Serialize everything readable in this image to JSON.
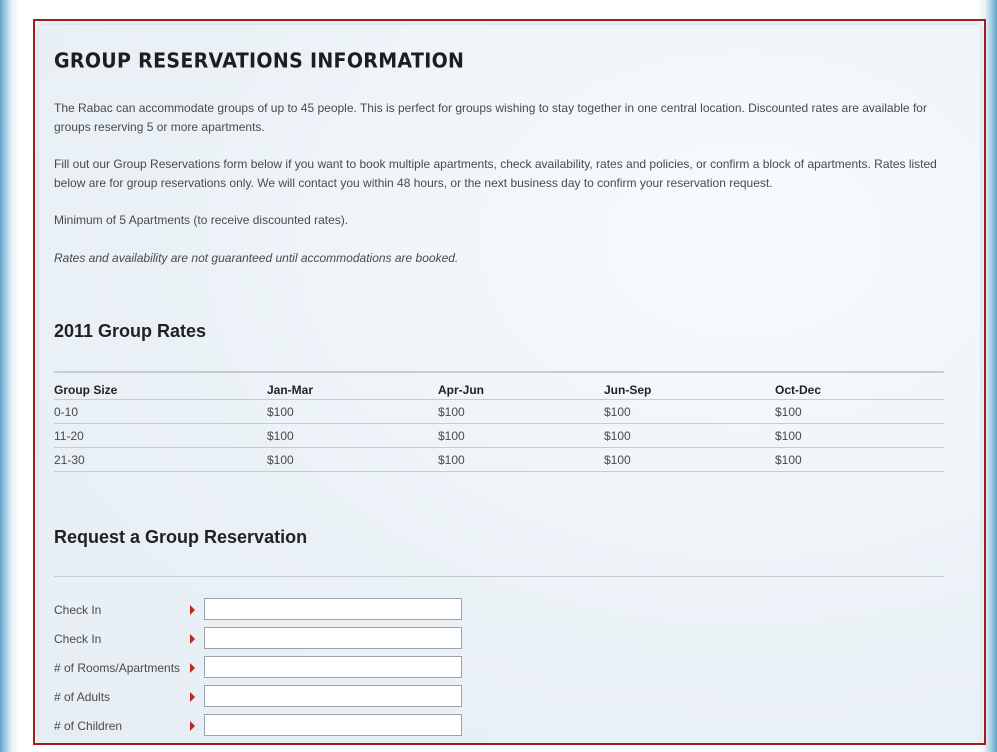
{
  "page": {
    "title": "GROUP RESERVATIONS INFORMATION",
    "paragraphs": [
      "The Rabac can accommodate groups of up to 45 people. This is perfect for groups wishing to stay together in one central location. Discounted rates are available for groups reserving 5 or more apartments.",
      "Fill out our Group Reservations form below if you want to book multiple apartments, check availability, rates and policies, or confirm a block of apartments. Rates listed below are for group reservations only. We will contact you within 48 hours, or the next business day to confirm your reservation request.",
      "Minimum of 5 Apartments (to receive discounted rates).",
      "Rates and availability are not guaranteed until accommodations are booked."
    ]
  },
  "rates": {
    "heading": "2011 Group Rates",
    "columns": [
      "Group Size",
      "Jan-Mar",
      "Apr-Jun",
      "Jun-Sep",
      "Oct-Dec"
    ],
    "rows": [
      [
        "0-10",
        "$100",
        "$100",
        "$100",
        "$100"
      ],
      [
        "11-20",
        "$100",
        "$100",
        "$100",
        "$100"
      ],
      [
        "21-30",
        "$100",
        "$100",
        "$100",
        "$100"
      ]
    ]
  },
  "form": {
    "heading": "Request a Group Reservation",
    "fields": [
      {
        "label": "Check In",
        "value": ""
      },
      {
        "label": "Check In",
        "value": ""
      },
      {
        "label": "# of Rooms/Apartments",
        "value": ""
      },
      {
        "label": "# of Adults",
        "value": ""
      },
      {
        "label": "# of Children",
        "value": ""
      },
      {
        "label": "",
        "value": ""
      }
    ]
  },
  "colors": {
    "accent_border": "#a01d22",
    "arrow": "#c0281e",
    "text": "#4a4a4a"
  },
  "icons": {
    "field_marker": "arrow-right-icon"
  }
}
